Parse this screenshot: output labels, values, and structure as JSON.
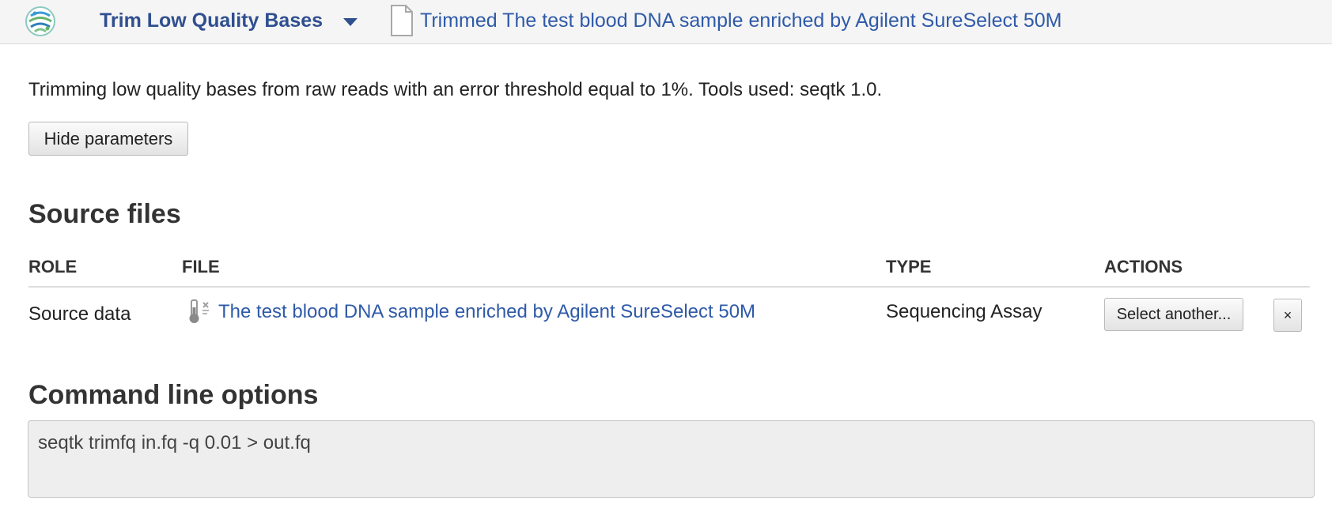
{
  "header": {
    "logo_icon": "genestack-logo-icon",
    "tool_name": "Trim Low Quality Bases",
    "file_icon": "document-icon",
    "file_title": "Trimmed The test blood DNA sample enriched by Agilent SureSelect 50M"
  },
  "description": "Trimming low quality bases from raw reads with an error threshold equal to 1%. Tools used: seqtk 1.0.",
  "buttons": {
    "hide_parameters": "Hide parameters"
  },
  "source_files": {
    "title": "Source files",
    "columns": [
      "ROLE",
      "FILE",
      "TYPE",
      "ACTIONS"
    ],
    "rows": [
      {
        "role": "Source data",
        "file_icon": "test-tube-icon",
        "file": "The test blood DNA sample enriched by Agilent SureSelect 50M",
        "type": "Sequencing Assay",
        "select_label": "Select another...",
        "remove_label": "×"
      }
    ]
  },
  "command_line": {
    "title": "Command line options",
    "value": "seqtk trimfq in.fq -q 0.01 > out.fq"
  },
  "colors": {
    "link": "#2f5aa8",
    "tool_name": "#2f4f8f",
    "topbar_bg": "#f5f5f5",
    "text": "#333333"
  }
}
